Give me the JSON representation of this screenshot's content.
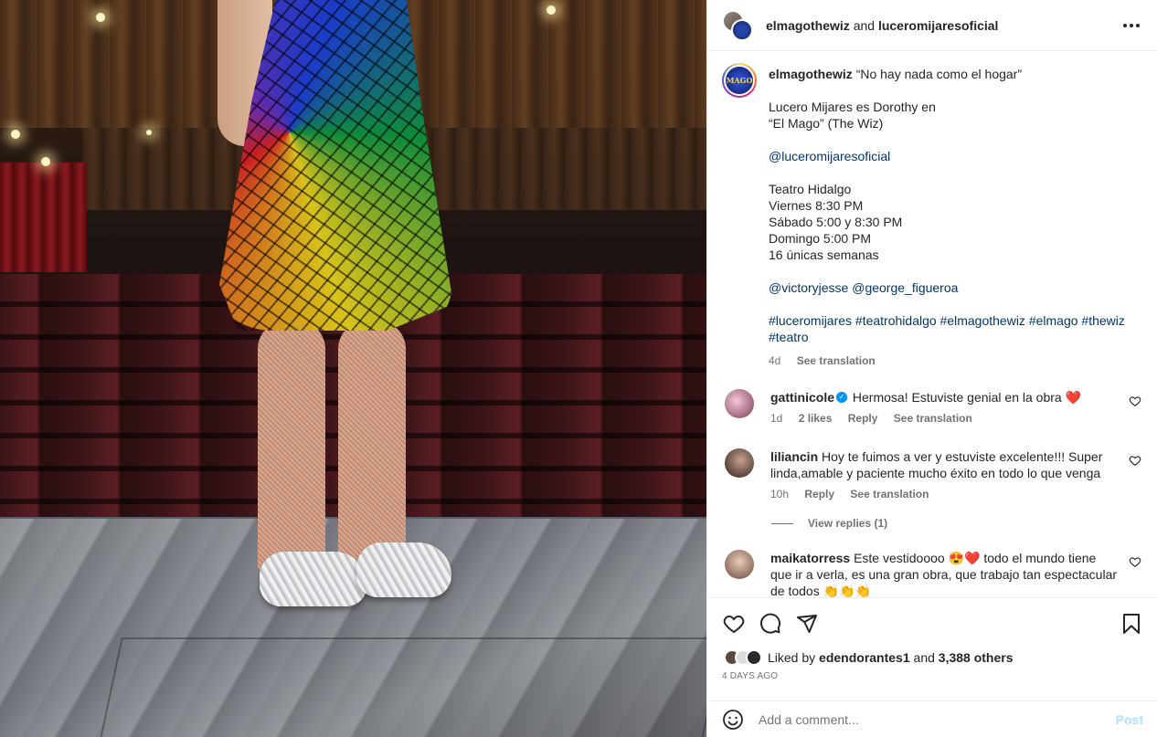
{
  "header": {
    "user1": "elmagothewiz",
    "and": "and",
    "user2": "luceromijaresoficial"
  },
  "caption": {
    "username": "elmagothewiz",
    "logo_text": "MAGO",
    "lines": [
      "“No hay nada como el hogar”",
      "",
      "Lucero Mijares es Dorothy en",
      "“El Mago” (The Wiz)",
      "",
      "@luceromijaresoficial",
      "",
      "Teatro Hidalgo",
      "Viernes 8:30 PM",
      "Sábado 5:00 y 8:30 PM",
      "Domingo 5:00 PM",
      "16 únicas semanas",
      "",
      "@victoryjesse @george_figueroa",
      "",
      "#luceromijares #teatrohidalgo #elmagothewiz #elmago #thewiz",
      "#teatro"
    ],
    "time": "4d",
    "see_translation": "See translation"
  },
  "comments": [
    {
      "username": "gattinicole",
      "verified": true,
      "text": "Hermosa! Estuviste genial en la obra ❤️",
      "time": "1d",
      "likes": "2 likes",
      "reply": "Reply",
      "see_translation": "See translation"
    },
    {
      "username": "liliancin",
      "text": "Hoy te fuimos a ver y estuviste excelente!!! Super linda,amable y paciente mucho éxito en todo lo que venga",
      "time": "10h",
      "reply": "Reply",
      "see_translation": "See translation",
      "view_replies": "View replies (1)"
    },
    {
      "username": "maikatorress",
      "text": "Este vestidoooo 😍❤️ todo el mundo tiene que ir a verla, es una gran obra, que trabajo tan espectacular de todos 👏👏👏"
    }
  ],
  "likes": {
    "prefix": "Liked by",
    "user": "edendorantes1",
    "and": "and",
    "others": "3,388 others"
  },
  "date": "4 DAYS AGO",
  "add_comment": {
    "placeholder": "Add a comment...",
    "post": "Post"
  },
  "colors": {
    "link": "#00376b",
    "verified": "#0095f6",
    "heart": "#ed4956",
    "post_disabled": "#b2dffc"
  },
  "icons": {
    "more": "more-horizontal-icon",
    "like": "heart-icon",
    "comment": "comment-icon",
    "share": "send-icon",
    "save": "bookmark-icon",
    "emoji": "emoji-icon"
  }
}
